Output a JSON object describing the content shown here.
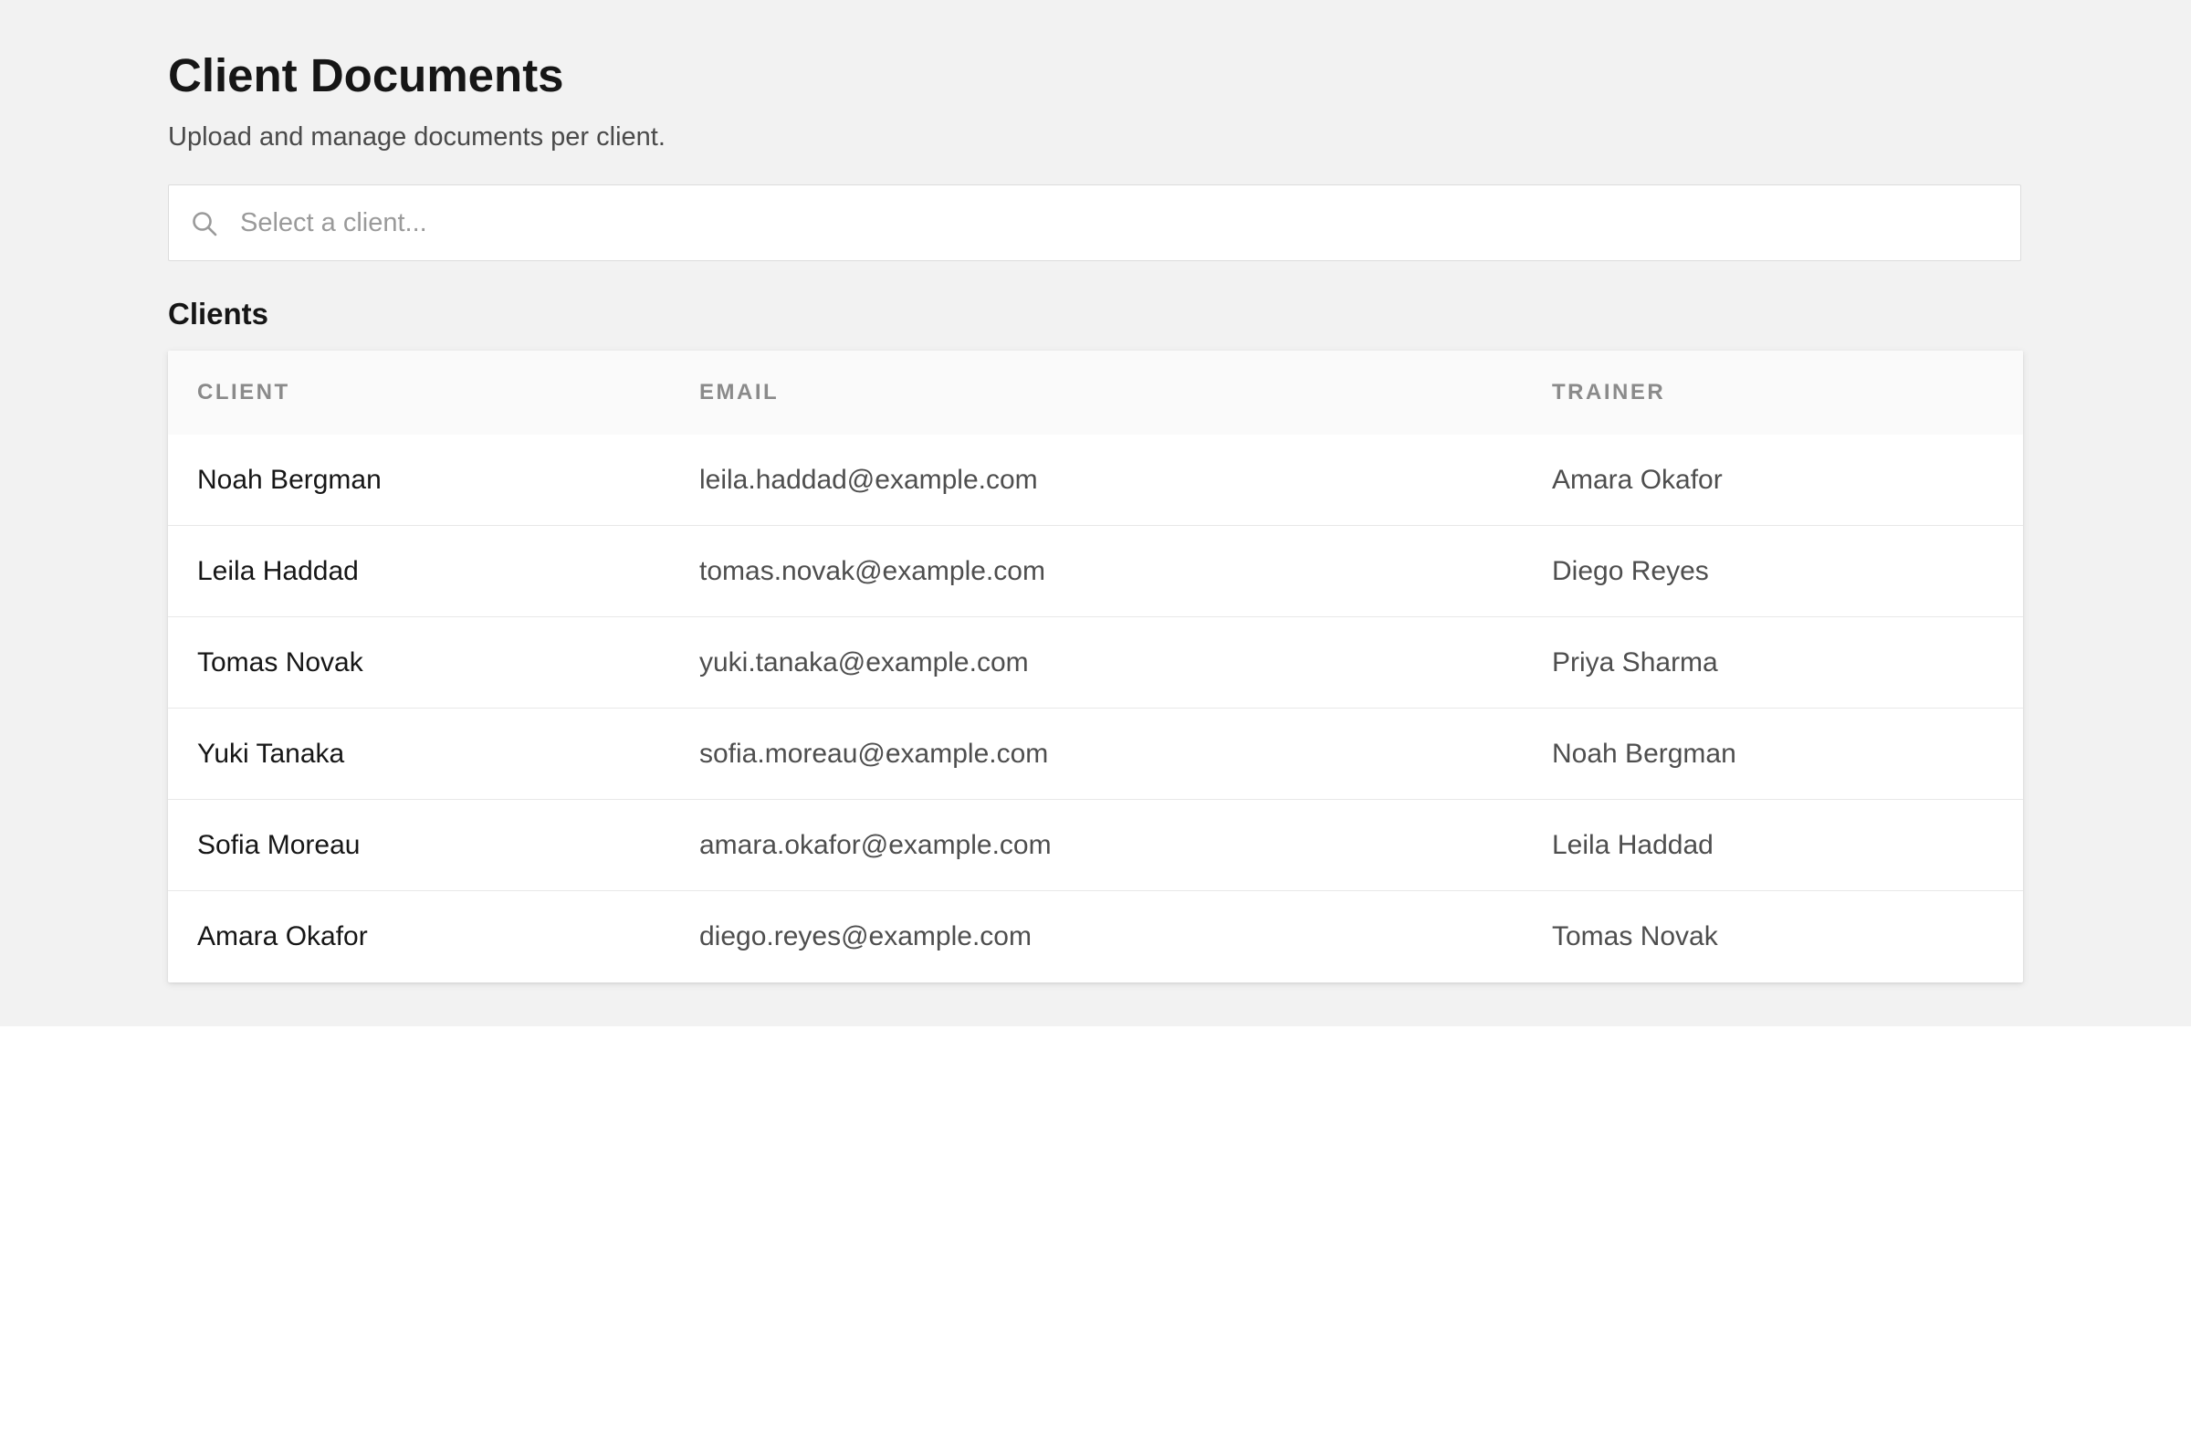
{
  "header": {
    "title": "Client Documents",
    "subtitle": "Upload and manage documents per client."
  },
  "search": {
    "placeholder": "Select a client...",
    "value": "",
    "icon": "search-icon"
  },
  "clients_section": {
    "title": "Clients",
    "columns": [
      "CLIENT",
      "EMAIL",
      "TRAINER"
    ],
    "rows": [
      {
        "client": "Noah Bergman",
        "email": "leila.haddad@example.com",
        "trainer": "Amara Okafor"
      },
      {
        "client": "Leila Haddad",
        "email": "tomas.novak@example.com",
        "trainer": "Diego Reyes"
      },
      {
        "client": "Tomas Novak",
        "email": "yuki.tanaka@example.com",
        "trainer": "Priya Sharma"
      },
      {
        "client": "Yuki Tanaka",
        "email": "sofia.moreau@example.com",
        "trainer": "Noah Bergman"
      },
      {
        "client": "Sofia Moreau",
        "email": "amara.okafor@example.com",
        "trainer": "Leila Haddad"
      },
      {
        "client": "Amara Okafor",
        "email": "diego.reyes@example.com",
        "trainer": "Tomas Novak"
      }
    ]
  },
  "colors": {
    "page_background": "#f2f2f2",
    "card_background": "#ffffff",
    "header_background": "#fafafa",
    "primary_text": "#161616",
    "secondary_text": "#4e4e4e",
    "muted_text": "#8a8a8a"
  }
}
